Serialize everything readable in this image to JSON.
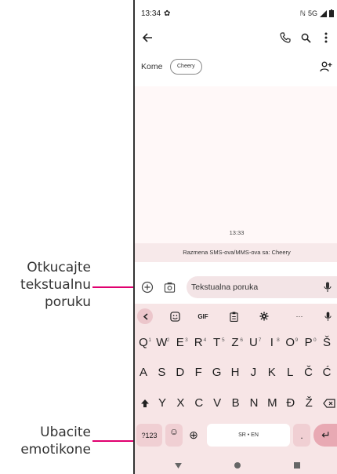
{
  "annotations": {
    "type_message": "Otkucajte\ntekstualnu\nporuku",
    "insert_emoji": "Ubacite\nemotikone"
  },
  "status_bar": {
    "time": "13:34",
    "network": "5G"
  },
  "recipient": {
    "label": "Kome",
    "chip": "Cheery"
  },
  "conversation": {
    "timestamp": "13:33",
    "banner": "Razmena SMS-ova/MMS-ova sa: Cheery"
  },
  "composer": {
    "placeholder": "Tekstualna poruka"
  },
  "keyboard": {
    "toolbar_gif": "GIF",
    "toolbar_more": "···",
    "row1": [
      "Q",
      "W",
      "E",
      "R",
      "T",
      "Z",
      "U",
      "I",
      "O",
      "P",
      "Š"
    ],
    "row1_hints": [
      "1",
      "2",
      "3",
      "4",
      "5",
      "6",
      "7",
      "8",
      "9",
      "0",
      ""
    ],
    "row2": [
      "A",
      "S",
      "D",
      "F",
      "G",
      "H",
      "J",
      "K",
      "L",
      "Č",
      "Ć"
    ],
    "row3": [
      "Y",
      "X",
      "C",
      "V",
      "B",
      "N",
      "M",
      "Đ",
      "Ž"
    ],
    "symbols_label": "?123",
    "emoji_key": "☺",
    "globe_key": "⊕",
    "space_label": "SR • EN",
    "period_key": ".",
    "enter_key": "↵"
  },
  "colors": {
    "accent": "#e0006f",
    "keyboard_bg": "#f7e5e6",
    "special_key": "#f0cfd3"
  }
}
